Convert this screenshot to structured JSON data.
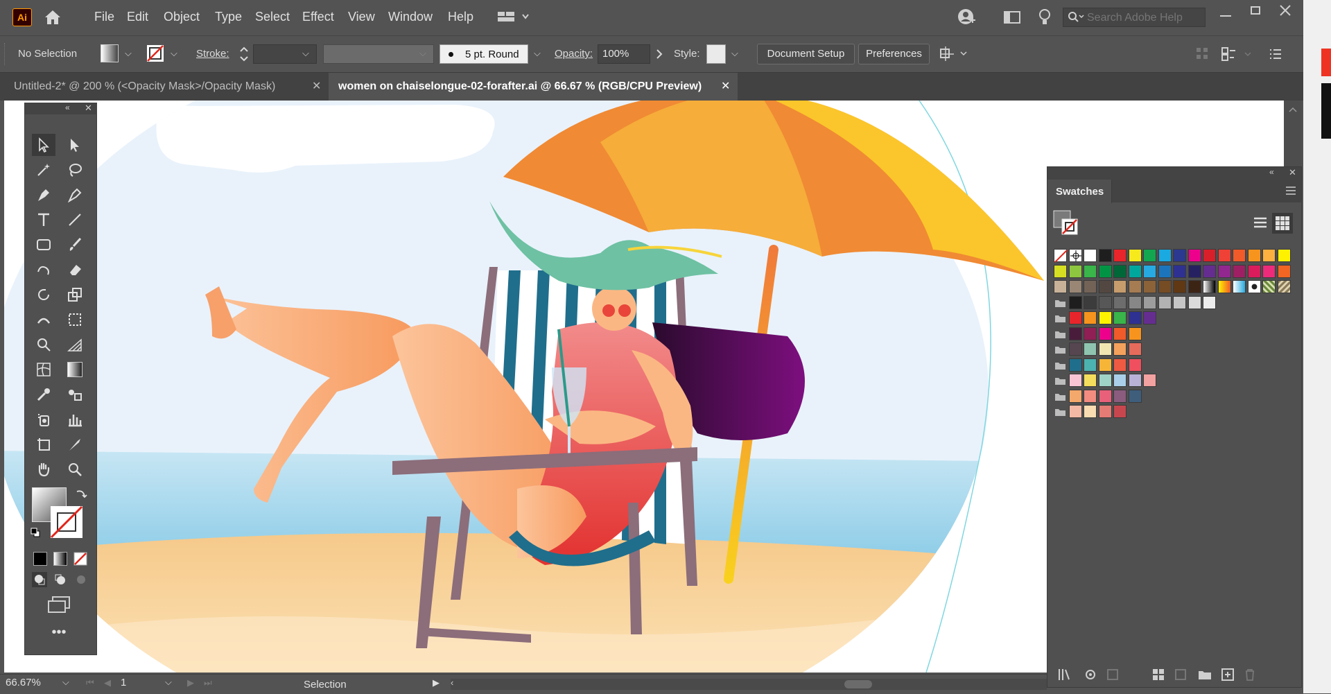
{
  "app": {
    "logo": "Ai"
  },
  "menu": [
    "File",
    "Edit",
    "Object",
    "Type",
    "Select",
    "Effect",
    "View",
    "Window",
    "Help"
  ],
  "search": {
    "placeholder": "Search Adobe Help"
  },
  "control": {
    "selection_label": "No Selection",
    "stroke_label": "Stroke:",
    "brush_label": "5 pt. Round",
    "opacity_label": "Opacity:",
    "opacity_value": "100%",
    "style_label": "Style:",
    "document_setup": "Document Setup",
    "preferences": "Preferences"
  },
  "tabs": [
    {
      "label": "Untitled-2* @ 200 % (<Opacity Mask>/Opacity Mask)",
      "active": false
    },
    {
      "label": "women on chaiselongue-02-forafter.ai @ 66.67 % (RGB/CPU Preview)",
      "active": true
    }
  ],
  "swatches_panel": {
    "title": "Swatches"
  },
  "status": {
    "zoom": "66.67%",
    "artboard": "1",
    "tool": "Selection"
  },
  "colors": {
    "sky": "#e9f2fb",
    "sea": "#7fc6e4",
    "sand": "#f6c98a",
    "umbrella_orange": "#f08a34",
    "umbrella_yellow": "#f7c21f",
    "swimsuit": "#e8453c",
    "hat": "#6ec1a3",
    "hair": "#6a0f6d",
    "skin": "#fbb783",
    "chair_frame": "#8c6d7a",
    "chair_stripe": "#1f6e8c"
  },
  "swatch_rows": [
    [
      "none",
      "reg",
      "#ffffff",
      "#1e1e1e",
      "#e8252b",
      "#f6ea1d",
      "#13a651",
      "#1aa9e1",
      "#2b3990",
      "#ec008c",
      "#d91f2a",
      "#ef4136",
      "#f15a29",
      "#f7941d",
      "#fbb040",
      "#fff200"
    ],
    [
      "#d7df23",
      "#8dc63f",
      "#39b54a",
      "#009444",
      "#006838",
      "#00a79d",
      "#27aae1",
      "#1c75bc",
      "#2e3192",
      "#262262",
      "#662d91",
      "#92278f",
      "#9e1f63",
      "#da1c5c",
      "#ee2a7b",
      "#f26522"
    ],
    [
      "#c7b299",
      "#998675",
      "#736357",
      "#534741",
      "#c69c6d",
      "#a67c52",
      "#8c6239",
      "#754c24",
      "#603813",
      "#3c2415",
      "grad-bw",
      "grad-orange",
      "grad-blue",
      "pattern1",
      "pattern2",
      "pattern3"
    ],
    [
      "folder",
      "#1e1e1e",
      "#3c3c3c",
      "#575757",
      "#6d6d6d",
      "#878787",
      "#9d9d9d",
      "#b2b2b2",
      "#c6c6c6",
      "#dadada",
      "#ececec"
    ],
    [
      "folder",
      "#e8252b",
      "#f7941d",
      "#fff200",
      "#39b54a",
      "#2e3192",
      "#662d91"
    ],
    [
      "folder",
      "#4a1c3c",
      "#8f1f55",
      "#ec008c",
      "#f15a29",
      "#f7941d"
    ],
    [
      "folder",
      "#564650",
      "#8fc5b0",
      "#f1e6b2",
      "#f4a15d",
      "#e66b5b"
    ],
    [
      "folder",
      "#1f6e8c",
      "#4cb3b0",
      "#f7b538",
      "#ef5a43",
      "#ef4f5e"
    ],
    [
      "folder",
      "#f9c5d5",
      "#f4dd5c",
      "#9ed3c6",
      "#a9d0e8",
      "#b9b2d6",
      "#f3a1a1"
    ],
    [
      "folder",
      "#f4a86b",
      "#f28c81",
      "#e8607a",
      "#8b5c7e",
      "#3e5e7c"
    ],
    [
      "folder",
      "#f3b9a4",
      "#f9dcb1",
      "#e47b74",
      "#c8474e"
    ]
  ]
}
